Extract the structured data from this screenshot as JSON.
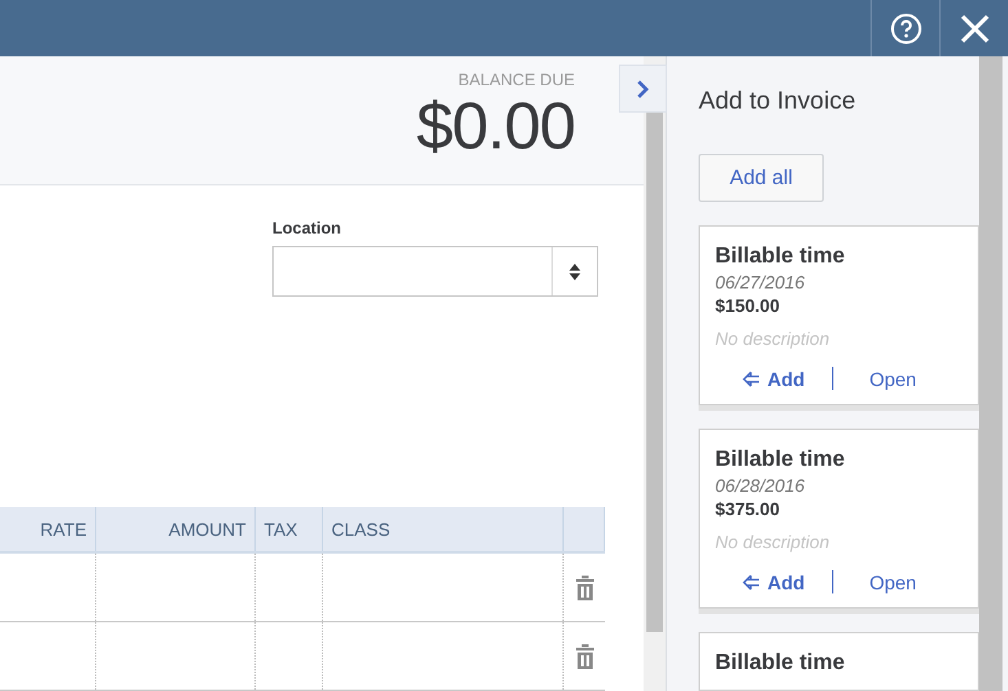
{
  "balance": {
    "label": "BALANCE DUE",
    "amount": "$0.00"
  },
  "location": {
    "label": "Location"
  },
  "table": {
    "columns": [
      "RATE",
      "AMOUNT",
      "TAX",
      "CLASS"
    ],
    "rows": [
      {
        "kind": "line"
      },
      {
        "kind": "line"
      }
    ]
  },
  "panel": {
    "title": "Add to Invoice",
    "add_all": "Add all",
    "cards": [
      {
        "title": "Billable time",
        "date": "06/27/2016",
        "amount": "$150.00",
        "description": "No description",
        "add": "Add",
        "open": "Open"
      },
      {
        "title": "Billable time",
        "date": "06/28/2016",
        "amount": "$375.00",
        "description": "No description",
        "add": "Add",
        "open": "Open"
      },
      {
        "title": "Billable time"
      }
    ]
  }
}
